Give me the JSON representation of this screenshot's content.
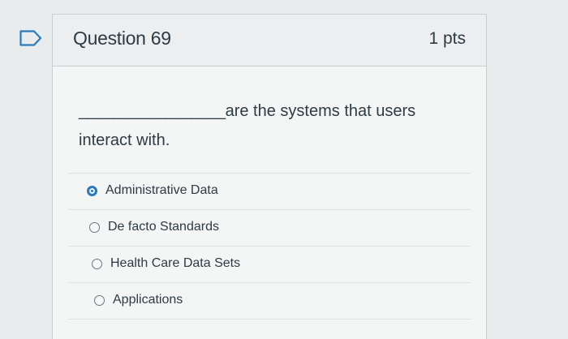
{
  "question": {
    "title": "Question 69",
    "points": "1 pts",
    "blank": "_________________",
    "text": "are the systems that users interact with."
  },
  "answers": [
    {
      "label": "Administrative Data",
      "selected": true
    },
    {
      "label": "De facto Standards",
      "selected": false
    },
    {
      "label": "Health Care Data Sets",
      "selected": false
    },
    {
      "label": "Applications",
      "selected": false
    }
  ],
  "colors": {
    "accent": "#2b7abc",
    "text": "#2d3b45",
    "border": "#c7cdd1"
  },
  "icons": {
    "flag": "bookmark-icon"
  }
}
